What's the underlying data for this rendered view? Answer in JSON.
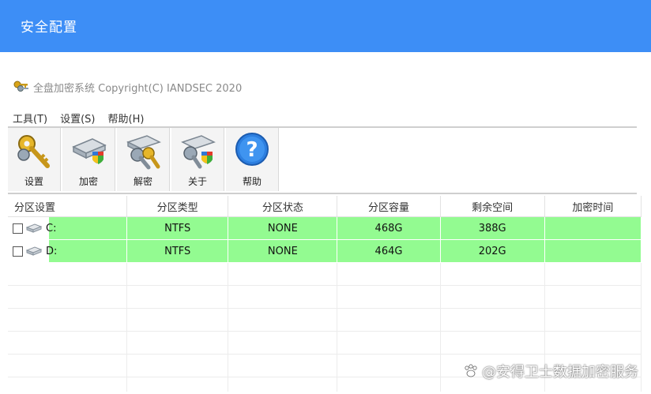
{
  "window": {
    "title": "安全配置"
  },
  "app": {
    "title": "全盘加密系统 Copyright(C) IANDSEC 2020",
    "icon": "keys-icon"
  },
  "menu": [
    {
      "label": "工具(T)"
    },
    {
      "label": "设置(S)"
    },
    {
      "label": "帮助(H)"
    }
  ],
  "toolbar": [
    {
      "label": "设置",
      "icon": "key-icon"
    },
    {
      "label": "加密",
      "icon": "shield-drive-icon"
    },
    {
      "label": "解密",
      "icon": "key-decrypt-icon"
    },
    {
      "label": "关于",
      "icon": "key-shield-icon"
    },
    {
      "label": "帮助",
      "icon": "help-icon"
    }
  ],
  "table": {
    "headers": [
      "分区设置",
      "分区类型",
      "分区状态",
      "分区容量",
      "剩余空间",
      "加密时间"
    ],
    "rows": [
      {
        "drive": "C:",
        "type": "NTFS",
        "status": "NONE",
        "capacity": "468G",
        "free": "388G",
        "time": ""
      },
      {
        "drive": "D:",
        "type": "NTFS",
        "status": "NONE",
        "capacity": "464G",
        "free": "202G",
        "time": ""
      }
    ],
    "row_color": "#93fb91"
  },
  "watermark": "@安得卫士数据加密服务",
  "colors": {
    "accent": "#3d8ef6",
    "row_highlight": "#93fb91"
  }
}
